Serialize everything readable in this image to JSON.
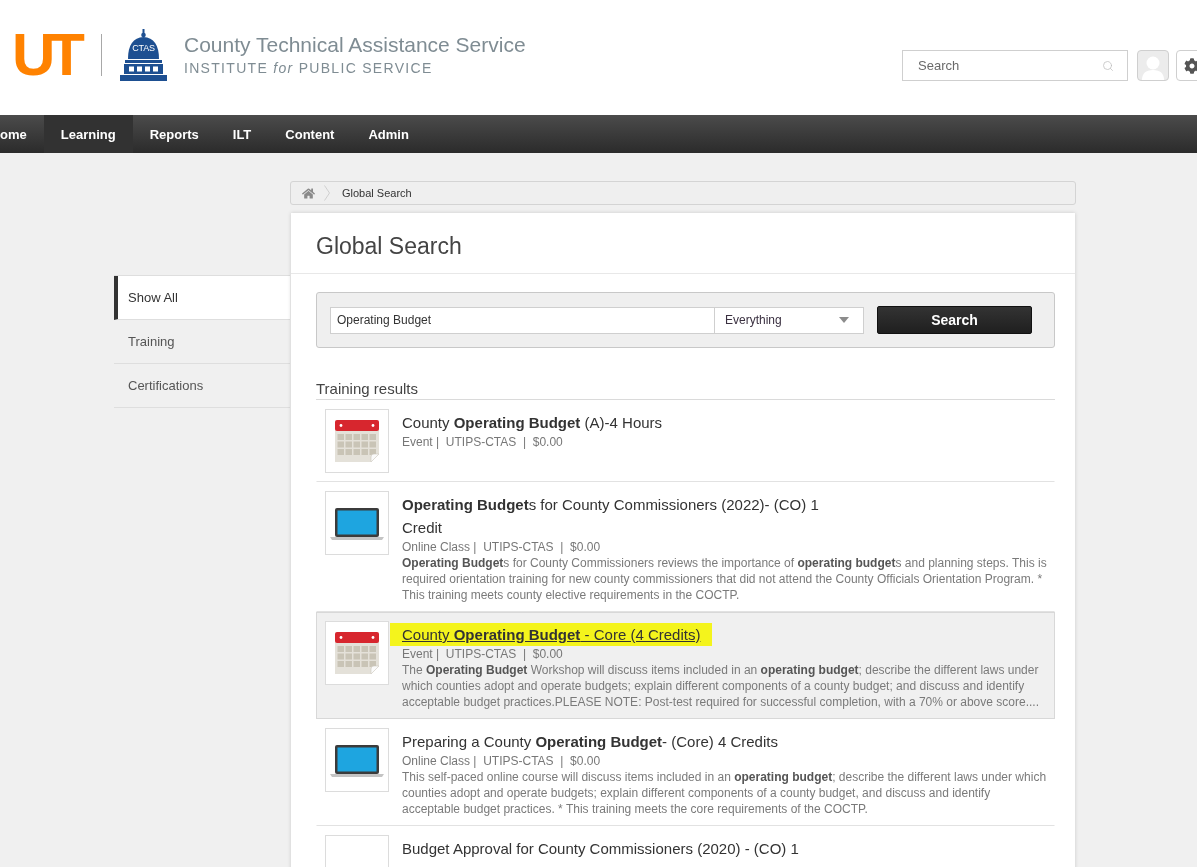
{
  "header": {
    "logo_text": "UT",
    "badge_text": "CTAS",
    "title": "County Technical Assistance Service",
    "subtitle": "INSTITUTE *for* PUBLIC SERVICE",
    "search": {
      "placeholder": "Search"
    }
  },
  "nav": [
    {
      "label": "ome",
      "selected": false
    },
    {
      "label": "Learning",
      "selected": true
    },
    {
      "label": "Reports",
      "selected": false
    },
    {
      "label": "ILT",
      "selected": false
    },
    {
      "label": "Content",
      "selected": false
    },
    {
      "label": "Admin",
      "selected": false
    }
  ],
  "breadcrumb": [
    "Global Search"
  ],
  "sidebar": {
    "items": [
      {
        "label": "Show All",
        "selected": true
      },
      {
        "label": "Training",
        "selected": false
      },
      {
        "label": "Certifications",
        "selected": false
      }
    ]
  },
  "page_title": "Global Search",
  "search_form": {
    "query": "Operating Budget",
    "scope": "Everything",
    "button": "Search"
  },
  "results": {
    "heading": "Training results",
    "items": [
      {
        "kind": "event",
        "title": "County **Operating Budget** (A)-4 Hours",
        "meta": "Event |  UTIPS-CTAS  |  $0.00",
        "selected": false,
        "highlighted": false
      },
      {
        "kind": "online_class",
        "title": "**Operating Budget**s for County Commissioners (2022)- (CO) 1 Credit",
        "meta": "Online Class |  UTIPS-CTAS  |  $0.00",
        "description": "**Operating Budget**s for County Commissioners reviews the importance of **operating budget**s and planning steps. This is required orientation training for new county commissioners that did not attend the County Officials Orientation Program. * This training meets county elective requirements in the COCTP.",
        "selected": false,
        "highlighted": false
      },
      {
        "kind": "event",
        "title": "County **Operating Budget** - Core (4 Credits)",
        "meta": "Event |  UTIPS-CTAS  |  $0.00",
        "description": "The **Operating Budget** Workshop will discuss items included in an **operating budget**; describe the different laws under which counties adopt and operate budgets; explain different components of a county budget; and discuss and identify acceptable budget practices.PLEASE NOTE: Post-test required for successful completion, with a 70% or above score....",
        "selected": true,
        "highlighted": true
      },
      {
        "kind": "online_class",
        "title": "Preparing a County **Operating Budget**- (Core) 4 Credits",
        "meta": "Online Class |  UTIPS-CTAS  |  $0.00",
        "description": "This self-paced online course will discuss items included in an **operating budget**; describe the different laws under which counties adopt and operate budgets; explain different components of a county budget, and discuss and identify acceptable budget practices. * This training meets the core requirements of the COCTP.",
        "selected": false,
        "highlighted": false
      },
      {
        "title": "Budget Approval for County Commissioners (2020) - (CO) 1",
        "selected": false,
        "highlighted": false
      }
    ]
  }
}
